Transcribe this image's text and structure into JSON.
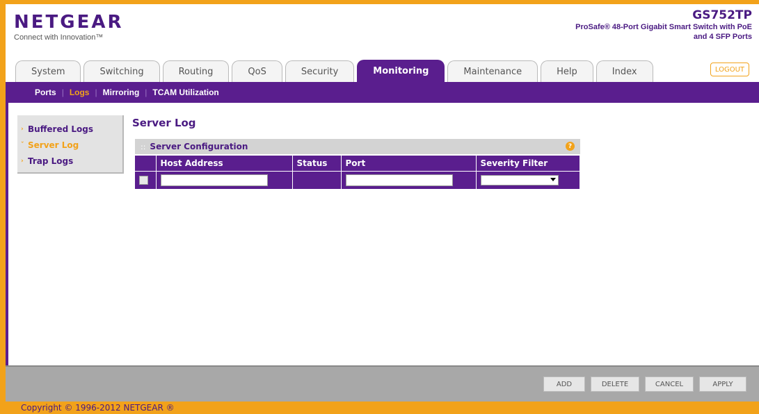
{
  "header": {
    "brand_name": "NETGEAR",
    "brand_tagline": "Connect with Innovation™",
    "model_name": "GS752TP",
    "model_desc": "ProSafe® 48-Port Gigabit Smart Switch with PoE and 4 SFP Ports",
    "logout_label": "LOGOUT"
  },
  "tabs": [
    {
      "label": "System"
    },
    {
      "label": "Switching"
    },
    {
      "label": "Routing"
    },
    {
      "label": "QoS"
    },
    {
      "label": "Security"
    },
    {
      "label": "Monitoring",
      "active": true
    },
    {
      "label": "Maintenance"
    },
    {
      "label": "Help"
    },
    {
      "label": "Index"
    }
  ],
  "subnav": [
    {
      "label": "Ports"
    },
    {
      "label": "Logs",
      "active": true
    },
    {
      "label": "Mirroring"
    },
    {
      "label": "TCAM Utilization"
    }
  ],
  "left_nav": [
    {
      "label": "Buffered Logs",
      "icon": "chevron-right-icon"
    },
    {
      "label": "Server Log",
      "icon": "chevron-down-icon",
      "active": true
    },
    {
      "label": "Trap Logs",
      "icon": "chevron-right-icon"
    }
  ],
  "page_title": "Server Log",
  "section": {
    "title": "Server Configuration",
    "help_icon": "?"
  },
  "table": {
    "columns": [
      "Host Address",
      "Status",
      "Port",
      "Severity Filter"
    ],
    "row": {
      "host_address": "",
      "status": "",
      "port": "",
      "severity_filter": ""
    }
  },
  "buttons": {
    "add": "ADD",
    "delete": "DELETE",
    "cancel": "CANCEL",
    "apply": "APPLY"
  },
  "footer": {
    "copyright": "Copyright © 1996-2012 NETGEAR ®"
  },
  "colors": {
    "brand_purple": "#5a1e8e",
    "accent_orange": "#f2a21a"
  }
}
